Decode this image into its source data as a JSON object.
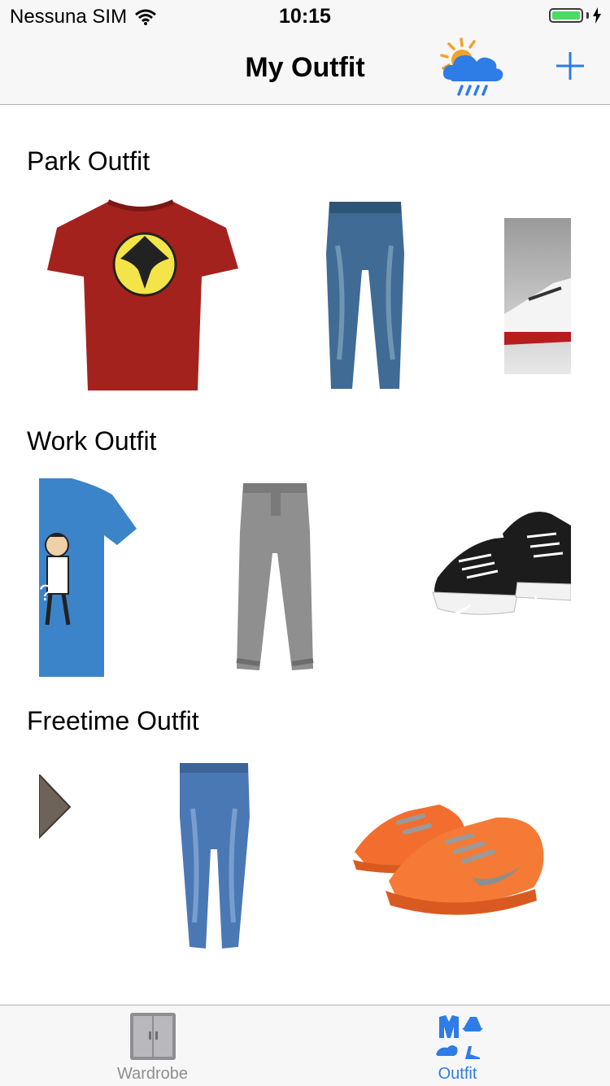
{
  "status_bar": {
    "carrier": "Nessuna SIM",
    "time": "10:15",
    "battery_level": 1.0
  },
  "nav": {
    "title": "My Outfit",
    "weather_icon": "weather-cloud-rain-sun-icon",
    "add_icon": "plus-icon"
  },
  "outfits": [
    {
      "title": "Park Outfit",
      "items": [
        "red-tshirt-image",
        "blue-jeans-image",
        "white-sneaker-photo-image"
      ]
    },
    {
      "title": "Work Outfit",
      "items": [
        "blue-cartoon-tshirt-image",
        "gray-chinos-image",
        "black-converse-sneakers-image"
      ]
    },
    {
      "title": "Freetime Outfit",
      "items": [
        "gray-shirt-image",
        "skinny-jeans-image",
        "orange-running-shoes-image"
      ]
    }
  ],
  "tab_bar": {
    "tabs": [
      {
        "label": "Wardrobe",
        "icon": "wardrobe-icon",
        "selected": false
      },
      {
        "label": "Outfit",
        "icon": "outfit-icon",
        "selected": true
      }
    ]
  },
  "colors": {
    "accent": "#2e7ce6",
    "inactive": "#8e8e93",
    "battery": "#4cd964"
  }
}
